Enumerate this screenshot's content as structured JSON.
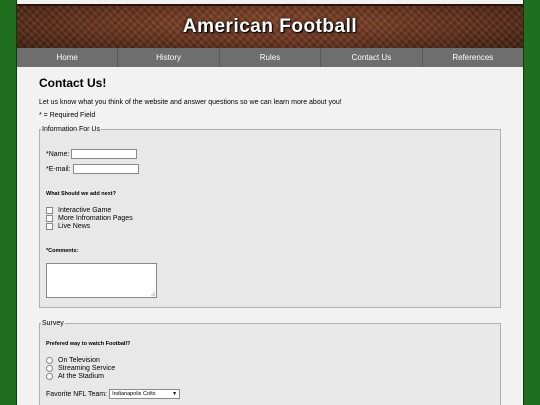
{
  "header": {
    "title": "American Football"
  },
  "nav": {
    "items": [
      "Home",
      "History",
      "Rules",
      "Contact Us",
      "References"
    ]
  },
  "main": {
    "title": "Contact Us!",
    "intro": "Let us know what you think of the website and answer questions so we can learn more about you!",
    "required_note": "* = Required Field"
  },
  "info_fieldset": {
    "legend": "Information For Us",
    "name_label": "*Name:",
    "email_label": "*E-mail:",
    "add_question": "What Should we add next?",
    "options": [
      "Interactive Game",
      "More Infromation Pages",
      "Live News"
    ],
    "comments_label": "*Comments:"
  },
  "survey_fieldset": {
    "legend": "Survey",
    "question": "Prefered way to watch Football?",
    "options": [
      "On Television",
      "Streaming Service",
      "At the Stadium"
    ],
    "team_label": "Favorite NFL Team:",
    "team_value": "Indianapolis Colts"
  }
}
